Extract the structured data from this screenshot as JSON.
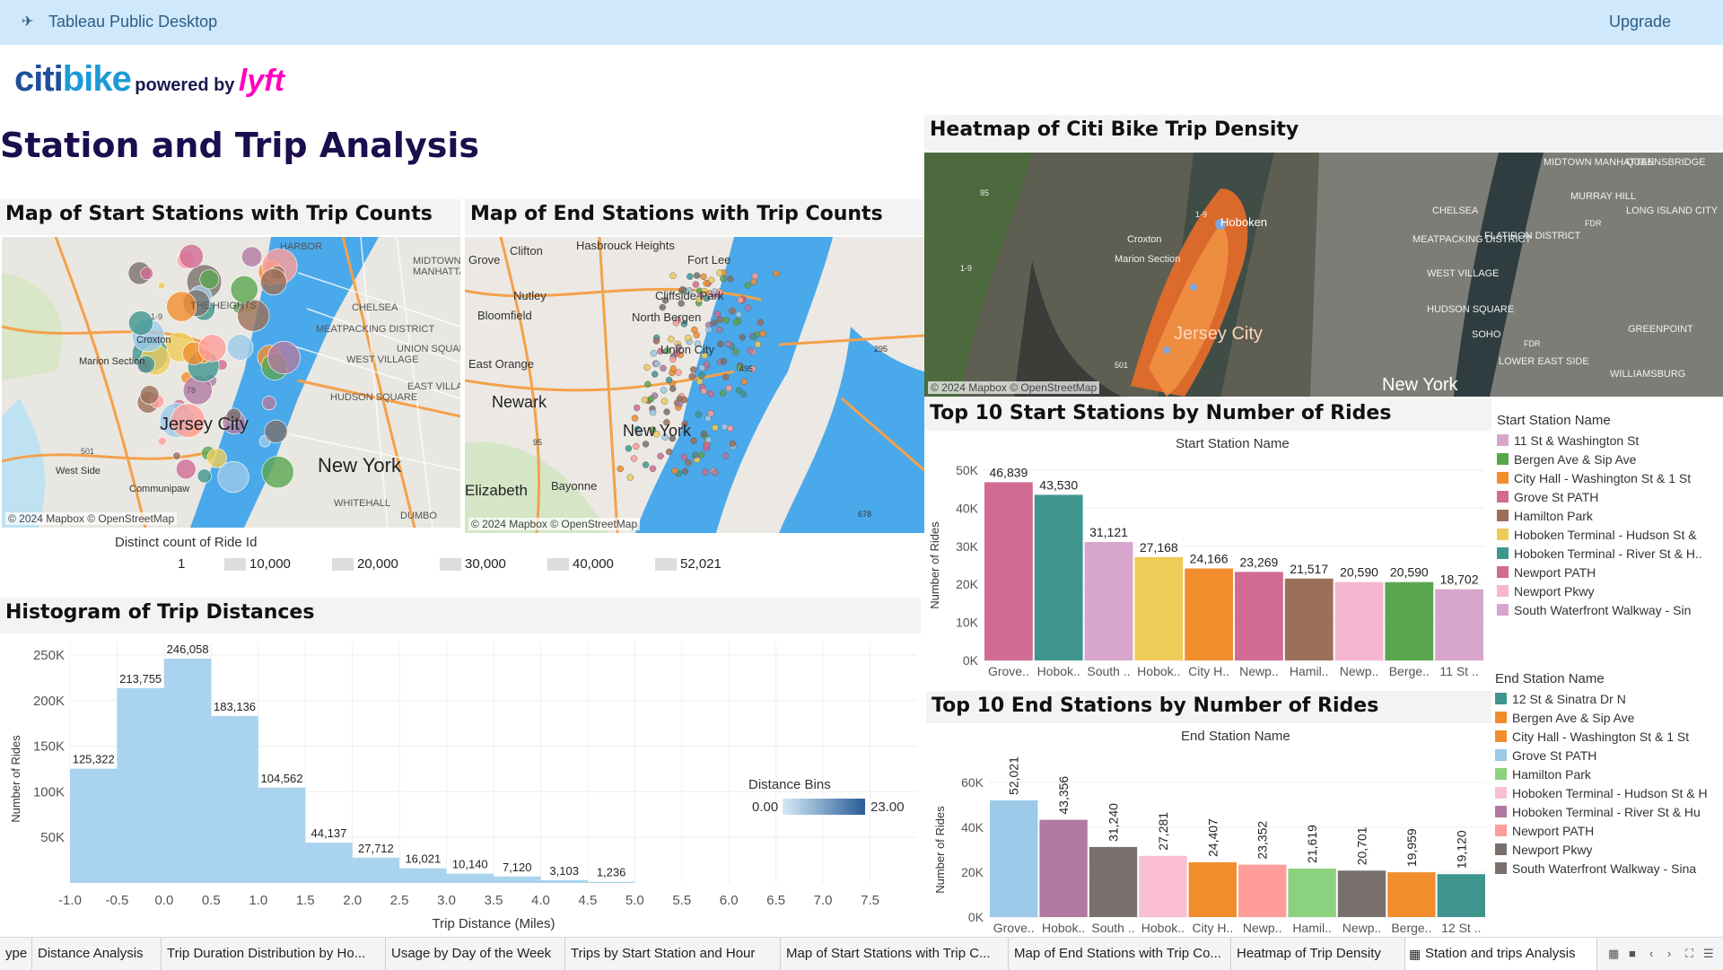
{
  "app": {
    "title": "Tableau Public Desktop",
    "upgrade_label": "Upgrade"
  },
  "logo": {
    "brand_a": "citi",
    "brand_b": "bike",
    "powered": "powered by",
    "lyft": "lyft"
  },
  "dashboard_title": "Station and Trip Analysis",
  "maps": {
    "start_title": "Map of Start Stations with Trip Counts",
    "end_title": "Map of End Stations with Trip Counts",
    "heatmap_title": "Heatmap of Citi Bike Trip Density",
    "credit": "© 2024 Mapbox © OpenStreetMap",
    "start_labels": [
      "HARBOR",
      "MIDTOWN",
      "MANHATTAN",
      "CHELSEA",
      "THE HEIGHTS",
      "Croxton",
      "Marion Section",
      "MEATPACKING DISTRICT",
      "WEST VILLAGE",
      "UNION SQUARE",
      "EAST VILLAGE",
      "HUDSON SQUARE",
      "Jersey City",
      "West Side",
      "Communipaw",
      "New York",
      "WHITEHALL",
      "DUMBO",
      "1-9",
      "78",
      "501"
    ],
    "end_labels": [
      "Grove",
      "Clifton",
      "Hasbrouck Heights",
      "Fort Lee",
      "Nutley",
      "Cliffside Park",
      "Bloomfield",
      "North Bergen",
      "Union City",
      "East Orange",
      "Newark",
      "New York",
      "Elizabeth",
      "Bayonne",
      "95",
      "295",
      "495",
      "678"
    ],
    "heat_labels": [
      "MIDTOWN MANHATTAN",
      "QUEENSBRIDGE",
      "MURRAY HILL",
      "LONG ISLAND CITY",
      "CHELSEA",
      "FLATIRON DISTRICT",
      "MEATPACKING DISTRICT",
      "WEST VILLAGE",
      "HUDSON SQUARE",
      "SOHO",
      "LOWER EAST SIDE",
      "GREENPOINT",
      "WILLIAMSBURG",
      "Marion Section",
      "Croxton",
      "Jersey City",
      "New York",
      "Hoboken",
      "1-9",
      "1-9",
      "95",
      "FDR",
      "FDR",
      "501"
    ]
  },
  "size_legend": {
    "title": "Distinct count of Ride Id",
    "items": [
      "1",
      "10,000",
      "20,000",
      "30,000",
      "40,000",
      "52,021"
    ]
  },
  "histogram": {
    "title": "Histogram of Trip Distances",
    "ylabel": "Number of Rides",
    "xlabel": "Trip Distance (Miles)",
    "legend_title": "Distance Bins",
    "legend_min": "0.00",
    "legend_max": "23.00",
    "y_ticks": [
      "250K",
      "200K",
      "150K",
      "100K",
      "50K"
    ],
    "x_ticks": [
      "-1.0",
      "-0.5",
      "0.0",
      "0.5",
      "1.0",
      "1.5",
      "2.0",
      "2.5",
      "3.0",
      "3.5",
      "4.0",
      "4.5",
      "5.0",
      "5.5",
      "6.0",
      "6.5",
      "7.0",
      "7.5"
    ]
  },
  "chart_data": [
    {
      "type": "bar",
      "title": "Histogram of Trip Distances",
      "xlabel": "Trip Distance (Miles)",
      "ylabel": "Number of Rides",
      "bin_starts": [
        -1.0,
        -0.5,
        0.0,
        0.5,
        1.0,
        1.5,
        2.0,
        2.5,
        3.0,
        3.5,
        4.0,
        4.5
      ],
      "values": [
        125322,
        213755,
        246058,
        183136,
        104562,
        44137,
        27712,
        16021,
        10140,
        7120,
        3103,
        1236
      ],
      "labels": [
        "125,322",
        "213,755",
        "246,058",
        "183,136",
        "104,562",
        "44,137",
        "27,712",
        "16,021",
        "10,140",
        "7,120",
        "3,103",
        "1,236"
      ],
      "xlim": [
        -1.0,
        7.5
      ],
      "ylim": [
        0,
        250000
      ],
      "color": "#a9d3ee"
    },
    {
      "type": "bar",
      "title": "Top 10 Start Stations by Number of Rides",
      "header": "Start Station Name",
      "ylabel": "Number of Rides",
      "categories": [
        "Grove..",
        "Hobok..",
        "South ..",
        "Hobok..",
        "City H..",
        "Newp..",
        "Hamil..",
        "Newp..",
        "Berge..",
        "11 St .."
      ],
      "values": [
        46839,
        43530,
        31121,
        27168,
        24166,
        23269,
        21517,
        20590,
        20590,
        18702
      ],
      "labels": [
        "46,839",
        "43,530",
        "31,121",
        "27,168",
        "24,166",
        "23,269",
        "21,517",
        "20,590",
        "20,590",
        "18,702"
      ],
      "colors": [
        "#d16b93",
        "#3f968f",
        "#d8a6cc",
        "#efcc58",
        "#f28d2d",
        "#d16b93",
        "#9b6f5a",
        "#f7b6d1",
        "#5aa64f",
        "#d8a6cc"
      ],
      "y_ticks": [
        "50K",
        "40K",
        "30K",
        "20K",
        "10K",
        "0K"
      ],
      "ylim": [
        0,
        50000
      ],
      "legend_title": "Start Station Name",
      "legend": [
        {
          "name": "11 St & Washington St",
          "color": "#d8a6cc"
        },
        {
          "name": "Bergen Ave & Sip Ave",
          "color": "#5aa64f"
        },
        {
          "name": "City Hall - Washington St & 1 St",
          "color": "#f28d2d"
        },
        {
          "name": "Grove St PATH",
          "color": "#d16b93"
        },
        {
          "name": "Hamilton Park",
          "color": "#9b6f5a"
        },
        {
          "name": "Hoboken Terminal - Hudson St &",
          "color": "#efcc58"
        },
        {
          "name": "Hoboken Terminal - River St & H..",
          "color": "#3f968f"
        },
        {
          "name": "Newport PATH",
          "color": "#d16b93"
        },
        {
          "name": "Newport Pkwy",
          "color": "#f7b6d1"
        },
        {
          "name": "South Waterfront Walkway - Sin",
          "color": "#d8a6cc"
        }
      ]
    },
    {
      "type": "bar",
      "title": "Top 10 End Stations by Number of Rides",
      "header": "End Station Name",
      "ylabel": "Number of Rides",
      "categories": [
        "Grove..",
        "Hobok..",
        "South ..",
        "Hobok..",
        "City H..",
        "Newp..",
        "Hamil..",
        "Newp..",
        "Berge..",
        "12 St .."
      ],
      "values": [
        52021,
        43356,
        31240,
        27281,
        24407,
        23352,
        21619,
        20701,
        19959,
        19120
      ],
      "labels": [
        "52,021",
        "43,356",
        "31,240",
        "27,281",
        "24,407",
        "23,352",
        "21,619",
        "20,701",
        "19,959",
        "19,120"
      ],
      "colors": [
        "#9ccae8",
        "#b07aa1",
        "#79706e",
        "#fabfd2",
        "#f28d2d",
        "#ff9d9a",
        "#8cd17d",
        "#79706e",
        "#f28d2d",
        "#3f968f"
      ],
      "y_ticks": [
        "60K",
        "40K",
        "20K",
        "0K"
      ],
      "ylim": [
        0,
        60000
      ],
      "legend_title": "End Station Name",
      "legend": [
        {
          "name": "12 St & Sinatra Dr N",
          "color": "#3f968f"
        },
        {
          "name": "Bergen Ave & Sip Ave",
          "color": "#f28d2d"
        },
        {
          "name": "City Hall - Washington St & 1 St",
          "color": "#f28d2d"
        },
        {
          "name": "Grove St PATH",
          "color": "#9ccae8"
        },
        {
          "name": "Hamilton Park",
          "color": "#8cd17d"
        },
        {
          "name": "Hoboken Terminal - Hudson St & H",
          "color": "#fabfd2"
        },
        {
          "name": "Hoboken Terminal - River St & Hu",
          "color": "#b07aa1"
        },
        {
          "name": "Newport PATH",
          "color": "#ff9d9a"
        },
        {
          "name": "Newport Pkwy",
          "color": "#79706e"
        },
        {
          "name": "South Waterfront Walkway - Sina",
          "color": "#79706e"
        }
      ]
    }
  ],
  "tabs": [
    "ype",
    "Distance Analysis",
    "Trip Duration Distribution by Ho...",
    "Usage by Day of the Week",
    "Trips by Start Station and Hour",
    "Map of Start Stations with Trip C...",
    "Map of End Stations with Trip Co...",
    "Heatmap of Trip Density",
    "Station and trips Analysis"
  ],
  "colors": {
    "accent": "#2b5d86",
    "title": "#1b0d4e",
    "topbar": "#cfe8fb",
    "water": "#4aa9ea"
  }
}
